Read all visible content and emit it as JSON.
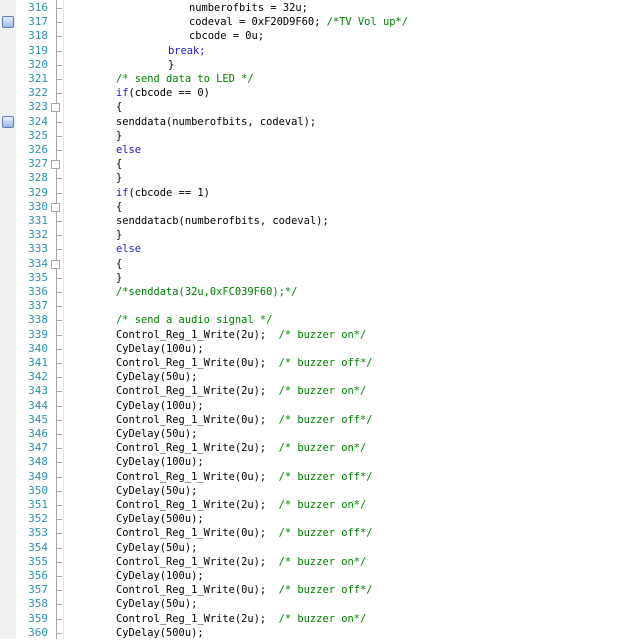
{
  "colors": {
    "line_number": "#2b91af",
    "keyword": "#1a1ac8",
    "comment": "#008000",
    "code": "#000000",
    "background": "#ffffff"
  },
  "lines": [
    {
      "n": "316",
      "indent": 5,
      "bm": false,
      "fold": "tick",
      "parts": [
        {
          "t": "numberofbits = 32u;",
          "c": "nm"
        }
      ]
    },
    {
      "n": "317",
      "indent": 5,
      "bm": true,
      "fold": "tick",
      "parts": [
        {
          "t": "codeval = 0xF20D9F60; ",
          "c": "nm"
        },
        {
          "t": "/*TV Vol up*/",
          "c": "cm"
        }
      ]
    },
    {
      "n": "318",
      "indent": 5,
      "bm": false,
      "fold": "tick",
      "parts": [
        {
          "t": "cbcode = 0u;",
          "c": "nm"
        }
      ]
    },
    {
      "n": "319",
      "indent": 4,
      "bm": false,
      "fold": "tick",
      "parts": [
        {
          "t": "break;",
          "c": "kw"
        }
      ]
    },
    {
      "n": "320",
      "indent": 4,
      "bm": false,
      "fold": "tick",
      "parts": [
        {
          "t": "}",
          "c": "nm"
        }
      ]
    },
    {
      "n": "321",
      "indent": 2,
      "bm": false,
      "fold": "tick",
      "parts": [
        {
          "t": "/* send data to LED */",
          "c": "cm"
        }
      ]
    },
    {
      "n": "322",
      "indent": 2,
      "bm": false,
      "fold": "tick",
      "parts": [
        {
          "t": "if",
          "c": "kw"
        },
        {
          "t": "(cbcode == 0)",
          "c": "nm"
        }
      ]
    },
    {
      "n": "323",
      "indent": 2,
      "bm": false,
      "fold": "box",
      "parts": [
        {
          "t": "{",
          "c": "nm"
        }
      ]
    },
    {
      "n": "324",
      "indent": 2,
      "bm": true,
      "fold": "tick",
      "parts": [
        {
          "t": "senddata(numberofbits, codeval);",
          "c": "nm"
        }
      ]
    },
    {
      "n": "325",
      "indent": 2,
      "bm": false,
      "fold": "tick",
      "parts": [
        {
          "t": "}",
          "c": "nm"
        }
      ]
    },
    {
      "n": "326",
      "indent": 2,
      "bm": false,
      "fold": "tick",
      "parts": [
        {
          "t": "else",
          "c": "kw"
        }
      ]
    },
    {
      "n": "327",
      "indent": 2,
      "bm": false,
      "fold": "box",
      "parts": [
        {
          "t": "{",
          "c": "nm"
        }
      ]
    },
    {
      "n": "328",
      "indent": 2,
      "bm": false,
      "fold": "tick",
      "parts": [
        {
          "t": "}",
          "c": "nm"
        }
      ]
    },
    {
      "n": "329",
      "indent": 2,
      "bm": false,
      "fold": "tick",
      "parts": [
        {
          "t": "if",
          "c": "kw"
        },
        {
          "t": "(cbcode == 1)",
          "c": "nm"
        }
      ]
    },
    {
      "n": "330",
      "indent": 2,
      "bm": false,
      "fold": "box",
      "parts": [
        {
          "t": "{",
          "c": "nm"
        }
      ]
    },
    {
      "n": "331",
      "indent": 2,
      "bm": false,
      "fold": "tick",
      "parts": [
        {
          "t": "senddatacb(numberofbits, codeval);",
          "c": "nm"
        }
      ]
    },
    {
      "n": "332",
      "indent": 2,
      "bm": false,
      "fold": "tick",
      "parts": [
        {
          "t": "}",
          "c": "nm"
        }
      ]
    },
    {
      "n": "333",
      "indent": 2,
      "bm": false,
      "fold": "tick",
      "parts": [
        {
          "t": "else",
          "c": "kw"
        }
      ]
    },
    {
      "n": "334",
      "indent": 2,
      "bm": false,
      "fold": "box",
      "parts": [
        {
          "t": "{",
          "c": "nm"
        }
      ]
    },
    {
      "n": "335",
      "indent": 2,
      "bm": false,
      "fold": "tick",
      "parts": [
        {
          "t": "}",
          "c": "nm"
        }
      ]
    },
    {
      "n": "336",
      "indent": 2,
      "bm": false,
      "fold": "tick",
      "parts": [
        {
          "t": "/*senddata(32u,0xFC039F60);*/",
          "c": "cm"
        }
      ]
    },
    {
      "n": "337",
      "indent": 0,
      "bm": false,
      "fold": "tick",
      "parts": []
    },
    {
      "n": "338",
      "indent": 2,
      "bm": false,
      "fold": "tick",
      "parts": [
        {
          "t": "/* send a audio signal */",
          "c": "cm"
        }
      ]
    },
    {
      "n": "339",
      "indent": 2,
      "bm": false,
      "fold": "tick",
      "parts": [
        {
          "t": "Control_Reg_1_Write(2u);  ",
          "c": "nm"
        },
        {
          "t": "/* buzzer on*/",
          "c": "cm"
        }
      ]
    },
    {
      "n": "340",
      "indent": 2,
      "bm": false,
      "fold": "tick",
      "parts": [
        {
          "t": "CyDelay(100u);",
          "c": "nm"
        }
      ]
    },
    {
      "n": "341",
      "indent": 2,
      "bm": false,
      "fold": "tick",
      "parts": [
        {
          "t": "Control_Reg_1_Write(0u);  ",
          "c": "nm"
        },
        {
          "t": "/* buzzer off*/",
          "c": "cm"
        }
      ]
    },
    {
      "n": "342",
      "indent": 2,
      "bm": false,
      "fold": "tick",
      "parts": [
        {
          "t": "CyDelay(50u);",
          "c": "nm"
        }
      ]
    },
    {
      "n": "343",
      "indent": 2,
      "bm": false,
      "fold": "tick",
      "parts": [
        {
          "t": "Control_Reg_1_Write(2u);  ",
          "c": "nm"
        },
        {
          "t": "/* buzzer on*/",
          "c": "cm"
        }
      ]
    },
    {
      "n": "344",
      "indent": 2,
      "bm": false,
      "fold": "tick",
      "parts": [
        {
          "t": "CyDelay(100u);",
          "c": "nm"
        }
      ]
    },
    {
      "n": "345",
      "indent": 2,
      "bm": false,
      "fold": "tick",
      "parts": [
        {
          "t": "Control_Reg_1_Write(0u);  ",
          "c": "nm"
        },
        {
          "t": "/* buzzer off*/",
          "c": "cm"
        }
      ]
    },
    {
      "n": "346",
      "indent": 2,
      "bm": false,
      "fold": "tick",
      "parts": [
        {
          "t": "CyDelay(50u);",
          "c": "nm"
        }
      ]
    },
    {
      "n": "347",
      "indent": 2,
      "bm": false,
      "fold": "tick",
      "parts": [
        {
          "t": "Control_Reg_1_Write(2u);  ",
          "c": "nm"
        },
        {
          "t": "/* buzzer on*/",
          "c": "cm"
        }
      ]
    },
    {
      "n": "348",
      "indent": 2,
      "bm": false,
      "fold": "tick",
      "parts": [
        {
          "t": "CyDelay(100u);",
          "c": "nm"
        }
      ]
    },
    {
      "n": "349",
      "indent": 2,
      "bm": false,
      "fold": "tick",
      "parts": [
        {
          "t": "Control_Reg_1_Write(0u);  ",
          "c": "nm"
        },
        {
          "t": "/* buzzer off*/",
          "c": "cm"
        }
      ]
    },
    {
      "n": "350",
      "indent": 2,
      "bm": false,
      "fold": "tick",
      "parts": [
        {
          "t": "CyDelay(50u);",
          "c": "nm"
        }
      ]
    },
    {
      "n": "351",
      "indent": 2,
      "bm": false,
      "fold": "tick",
      "parts": [
        {
          "t": "Control_Reg_1_Write(2u);  ",
          "c": "nm"
        },
        {
          "t": "/* buzzer on*/",
          "c": "cm"
        }
      ]
    },
    {
      "n": "352",
      "indent": 2,
      "bm": false,
      "fold": "tick",
      "parts": [
        {
          "t": "CyDelay(500u);",
          "c": "nm"
        }
      ]
    },
    {
      "n": "353",
      "indent": 2,
      "bm": false,
      "fold": "tick",
      "parts": [
        {
          "t": "Control_Reg_1_Write(0u);  ",
          "c": "nm"
        },
        {
          "t": "/* buzzer off*/",
          "c": "cm"
        }
      ]
    },
    {
      "n": "354",
      "indent": 2,
      "bm": false,
      "fold": "tick",
      "parts": [
        {
          "t": "CyDelay(50u);",
          "c": "nm"
        }
      ]
    },
    {
      "n": "355",
      "indent": 2,
      "bm": false,
      "fold": "tick",
      "parts": [
        {
          "t": "Control_Reg_1_Write(2u);  ",
          "c": "nm"
        },
        {
          "t": "/* buzzer on*/",
          "c": "cm"
        }
      ]
    },
    {
      "n": "356",
      "indent": 2,
      "bm": false,
      "fold": "tick",
      "parts": [
        {
          "t": "CyDelay(100u);",
          "c": "nm"
        }
      ]
    },
    {
      "n": "357",
      "indent": 2,
      "bm": false,
      "fold": "tick",
      "parts": [
        {
          "t": "Control_Reg_1_Write(0u);  ",
          "c": "nm"
        },
        {
          "t": "/* buzzer off*/",
          "c": "cm"
        }
      ]
    },
    {
      "n": "358",
      "indent": 2,
      "bm": false,
      "fold": "tick",
      "parts": [
        {
          "t": "CyDelay(50u);",
          "c": "nm"
        }
      ]
    },
    {
      "n": "359",
      "indent": 2,
      "bm": false,
      "fold": "tick",
      "parts": [
        {
          "t": "Control_Reg_1_Write(2u);  ",
          "c": "nm"
        },
        {
          "t": "/* buzzer on*/",
          "c": "cm"
        }
      ]
    },
    {
      "n": "360",
      "indent": 2,
      "bm": false,
      "fold": "tick",
      "parts": [
        {
          "t": "CyDelay(500u);",
          "c": "nm"
        }
      ]
    }
  ]
}
